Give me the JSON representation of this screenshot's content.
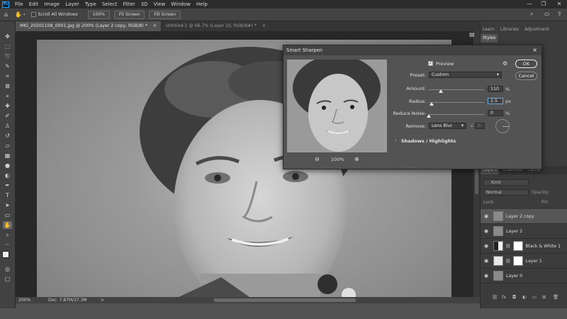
{
  "menubar": {
    "logo": "Ps",
    "items": [
      "File",
      "Edit",
      "Image",
      "Layer",
      "Type",
      "Select",
      "Filter",
      "3D",
      "View",
      "Window",
      "Help"
    ]
  },
  "optionsbar": {
    "scroll_all_windows": "Scroll All Windows",
    "zoom_value": "100%",
    "fit_screen": "Fit Screen",
    "fill_screen": "Fill Screen"
  },
  "tabs": [
    {
      "label": "IMG_20201108_0001.jpg @ 200% (Layer 2 copy, RGB/8) *",
      "close": "×"
    },
    {
      "label": "Untitled-1 @ 66.7% (Layer 10, RGB/8#) *",
      "close": "×"
    }
  ],
  "status": {
    "zoom": "200%",
    "doc": "Doc: 7.87M/37.3M",
    "arrow": ">"
  },
  "right_panel": {
    "top_tabs": [
      "Learn",
      "Libraries",
      "Adjustment",
      "Styles"
    ],
    "layers_tabs": [
      "Layers",
      "Channels",
      "Paths"
    ],
    "kind": "Kind",
    "mode": "Normal",
    "opacity_label": "Opacity:",
    "lock_label": "Lock:",
    "fill_label": "Fill:",
    "layers": [
      {
        "name": "Layer 2 copy",
        "active": true
      },
      {
        "name": "Layer 2",
        "active": false
      },
      {
        "name": "Black & White 1",
        "active": false
      },
      {
        "name": "Layer 1",
        "active": false
      },
      {
        "name": "Layer 0",
        "active": false
      }
    ],
    "footer_icons": [
      "link-icon",
      "fx-icon",
      "mask-icon",
      "adjustment-icon",
      "folder-icon",
      "new-layer-icon",
      "trash-icon"
    ]
  },
  "dialog": {
    "title": "Smart Sharpen",
    "close": "×",
    "preview_label": "Preview",
    "preset_label": "Preset:",
    "preset_value": "Custom",
    "amount_label": "Amount:",
    "amount_value": "110",
    "amount_unit": "%",
    "amount_level": 0.22,
    "radius_label": "Radius:",
    "radius_value": "2.5",
    "radius_unit": "px",
    "radius_level": 0.05,
    "noise_label": "Reduce Noise:",
    "noise_value": "0",
    "noise_unit": "%",
    "noise_level": 0,
    "remove_label": "Remove:",
    "remove_value": "Lens Blur",
    "remove_angle": "0",
    "zoom_level": "100%",
    "shadows_highlights": "Shadows / Highlights",
    "ok": "OK",
    "cancel": "Cancel"
  },
  "colors": {
    "app_bg": "#535353",
    "panel_bg": "#3c3c3c",
    "menubar_bg": "#2c2c2c",
    "accent": "#31a8ff"
  }
}
